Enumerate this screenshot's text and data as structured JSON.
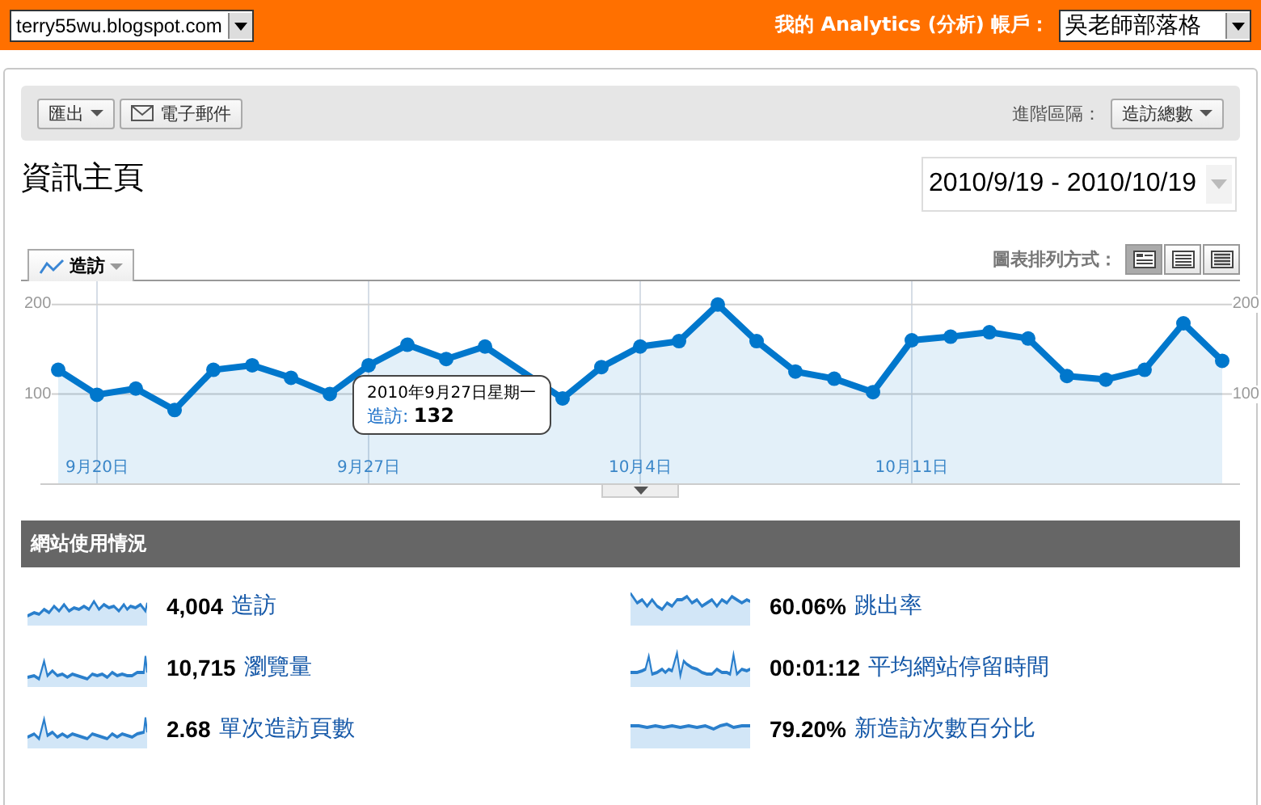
{
  "top_bar": {
    "site_select": "terry55wu.blogspot.com",
    "account_label": "我的 Analytics (分析) 帳戶：",
    "account_select": "吳老師部落格"
  },
  "toolbar": {
    "export_button": "匯出",
    "email_button": "電子郵件",
    "segment_label": "進階區隔：",
    "segment_select": "造訪總數"
  },
  "page_title": "資訊主頁",
  "date_range": "2010/9/19 - 2010/10/19",
  "chart_panel": {
    "view_label": "圖表排列方式：",
    "right_axis_labels": [
      "200",
      "100"
    ],
    "view_buttons": [
      {
        "selected": true
      },
      {
        "selected": false
      },
      {
        "selected": false
      }
    ],
    "tooltip": {
      "date": "2010年9月27日星期一",
      "metric": "造訪:",
      "value": "132"
    },
    "chart_data": {
      "type": "area",
      "grid": true,
      "categories": [
        null,
        "9月20日",
        null,
        null,
        null,
        null,
        null,
        null,
        "9月27日",
        null,
        null,
        null,
        null,
        null,
        null,
        "10月4日",
        null,
        null,
        null,
        null,
        null,
        null,
        "10月11日",
        null,
        null,
        null,
        null,
        null,
        null,
        null,
        null
      ],
      "series": [
        {
          "name": "造訪",
          "color": "#0077cc",
          "values": [
            127,
            99,
            106,
            82,
            127,
            132,
            118,
            100,
            132,
            155,
            139,
            153,
            null,
            95,
            130,
            153,
            159,
            200,
            159,
            125,
            117,
            102,
            160,
            164,
            169,
            162,
            120,
            116,
            127,
            179,
            137
          ]
        }
      ],
      "ylim": [
        0,
        226
      ],
      "yticks": [
        100,
        200
      ]
    }
  },
  "usage": {
    "title": "網站使用情況",
    "metrics": [
      {
        "value": "4,004",
        "label": "造訪"
      },
      {
        "value": "60.06%",
        "label": "跳出率"
      },
      {
        "value": "10,715",
        "label": "瀏覽量"
      },
      {
        "value": "00:01:12",
        "label": "平均網站停留時間"
      },
      {
        "value": "2.68",
        "label": "單次造訪頁數"
      },
      {
        "value": "79.20%",
        "label": "新造訪次數百分比"
      }
    ]
  }
}
